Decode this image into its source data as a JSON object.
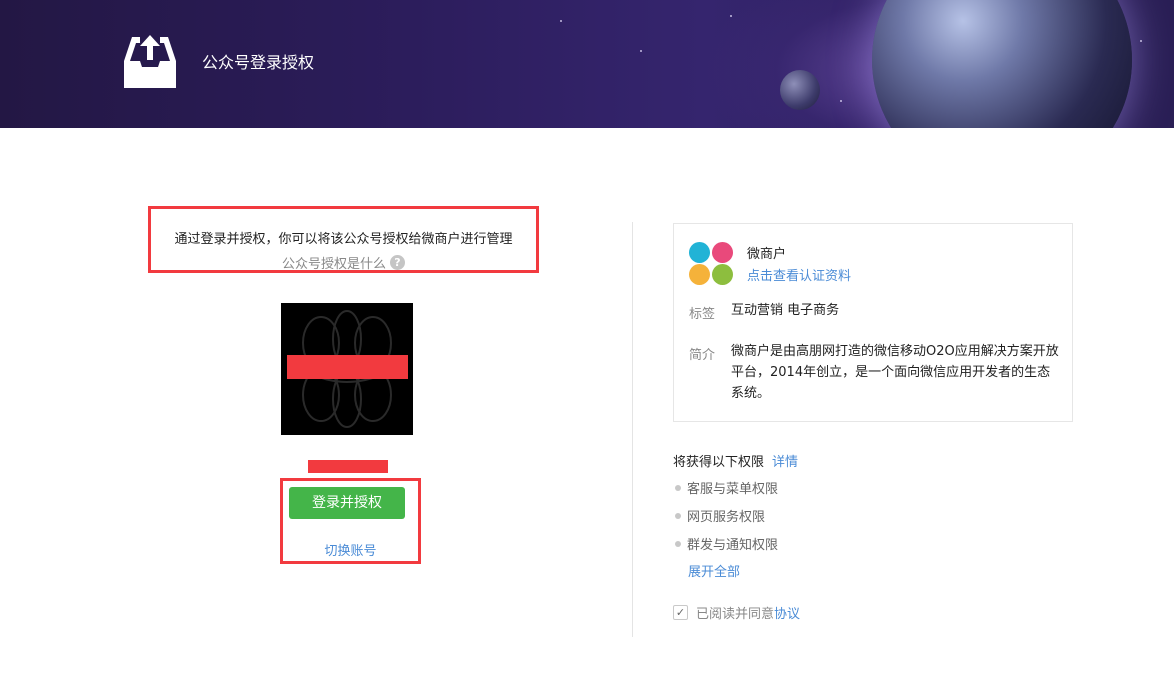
{
  "header": {
    "title": "公众号登录授权",
    "logo_icon": "upload-tray-icon"
  },
  "left": {
    "intro_text": "通过登录并授权，你可以将该公众号授权给微商户进行管理",
    "what_is_link": "公众号授权是什么",
    "help_glyph": "?",
    "login_button": "登录并授权",
    "switch_account": "切换账号"
  },
  "app": {
    "name": "微商户",
    "verify_link": "点击查看认证资料",
    "tags_label": "标签",
    "tags_value": "互动营销 电子商务",
    "intro_label": "简介",
    "intro_value": "微商户是由高朋网打造的微信移动O2O应用解决方案开放平台，2014年创立，是一个面向微信应用开发者的生态系统。"
  },
  "permissions": {
    "title": "将获得以下权限",
    "detail_link": "详情",
    "items": [
      "客服与菜单权限",
      "网页服务权限",
      "群发与通知权限"
    ],
    "expand_all": "展开全部"
  },
  "agreement": {
    "check_glyph": "✓",
    "text": "已阅读并同意",
    "link": "协议"
  },
  "colors": {
    "highlight": "#f23a3f",
    "primary_button": "#44b549",
    "link": "#4a8bd6"
  }
}
